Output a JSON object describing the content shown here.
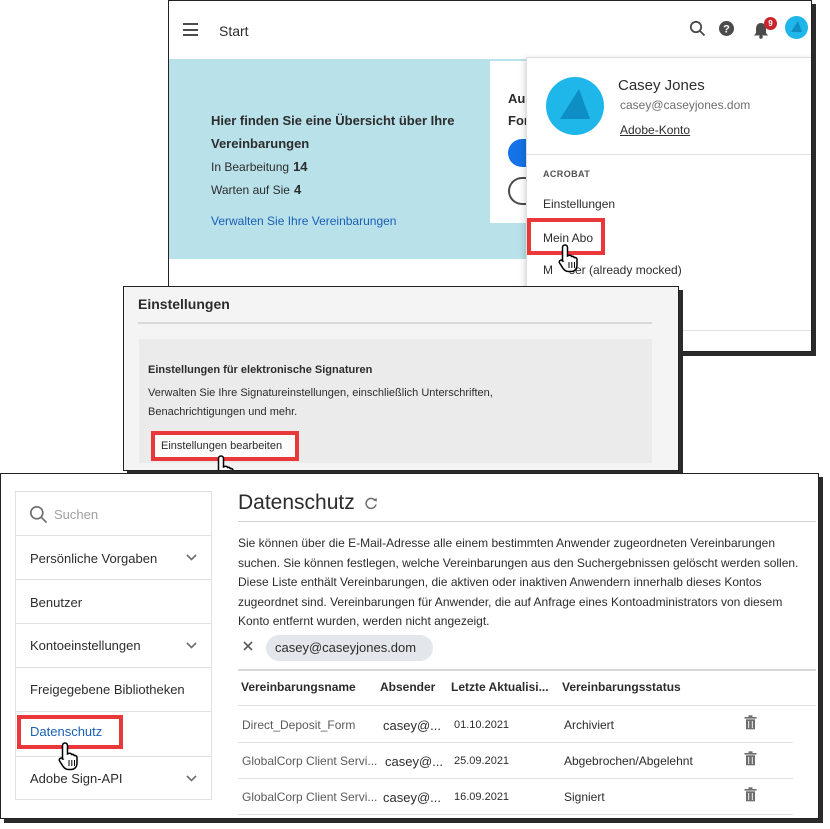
{
  "start_panel": {
    "title": "Start",
    "notification_count": "9",
    "hero": {
      "title": "Hier finden Sie eine Übersicht über Ihre Vereinbarungen",
      "in_progress_label": "In Bearbeitung",
      "in_progress_count": "14",
      "waiting_label": "Warten auf Sie",
      "waiting_count": "4",
      "manage_link": "Verwalten Sie Ihre Vereinbarungen",
      "card_line1": "Aus",
      "card_line2": "For"
    },
    "profile_menu": {
      "name": "Casey Jones",
      "email": "casey@caseyjones.dom",
      "account_link": "Adobe-Konto",
      "section_label": "ACROBAT",
      "items": [
        "Einstellungen",
        "Mein Abo",
        "Mock User (already mocked)"
      ],
      "item_partial_prefix": "M",
      "item_partial_suffix": "ser (already mocked)"
    }
  },
  "settings_panel": {
    "title": "Einstellungen",
    "card_title": "Einstellungen für elektronische Signaturen",
    "card_desc": "Verwalten Sie Ihre Signatureinstellungen, einschließlich Unterschriften, Benachrichtigungen und mehr.",
    "edit_button": "Einstellungen bearbeiten"
  },
  "privacy_panel": {
    "search_placeholder": "Suchen",
    "nav": [
      {
        "label": "Persönliche Vorgaben",
        "expandable": true
      },
      {
        "label": "Benutzer",
        "expandable": false
      },
      {
        "label": "Kontoeinstellungen",
        "expandable": true
      },
      {
        "label": "Freigegebene Bibliotheken",
        "expandable": false
      },
      {
        "label": "Datenschutz",
        "expandable": false,
        "active": true
      },
      {
        "label": "Adobe Sign-API",
        "expandable": true
      }
    ],
    "title": "Datenschutz",
    "description": "Sie können über die E-Mail-Adresse alle einem bestimmten Anwender zugeordneten Vereinbarungen suchen. Sie können festlegen, welche Vereinbarungen aus den Suchergebnissen gelöscht werden sollen. Diese Liste enthält Vereinbarungen, die aktiven oder inaktiven Anwendern innerhalb dieses Kontos zugeordnet sind. Vereinbarungen für Anwender, die auf Anfrage eines Kontoadministrators von diesem Konto entfernt wurden, werden nicht angezeigt.",
    "filter_chip": "casey@caseyjones.dom",
    "table": {
      "headers": [
        "Vereinbarungsname",
        "Absender",
        "Letzte Aktualisi...",
        "Vereinbarungsstatus"
      ],
      "rows": [
        {
          "name": "Direct_Deposit_Form",
          "sender": "casey@...",
          "date": "01.10.2021",
          "status": "Archiviert"
        },
        {
          "name": "GlobalCorp Client Servi...",
          "sender": "casey@...",
          "date": "25.09.2021",
          "status": "Abgebrochen/Abgelehnt"
        },
        {
          "name": "GlobalCorp Client Servi...",
          "sender": "casey@...",
          "date": "16.09.2021",
          "status": "Signiert"
        }
      ]
    }
  },
  "colors": {
    "highlight": "#e8383a",
    "hero_bg": "#b9e1ea",
    "link": "#1a5fb4",
    "avatar": "#1fb6ea"
  }
}
